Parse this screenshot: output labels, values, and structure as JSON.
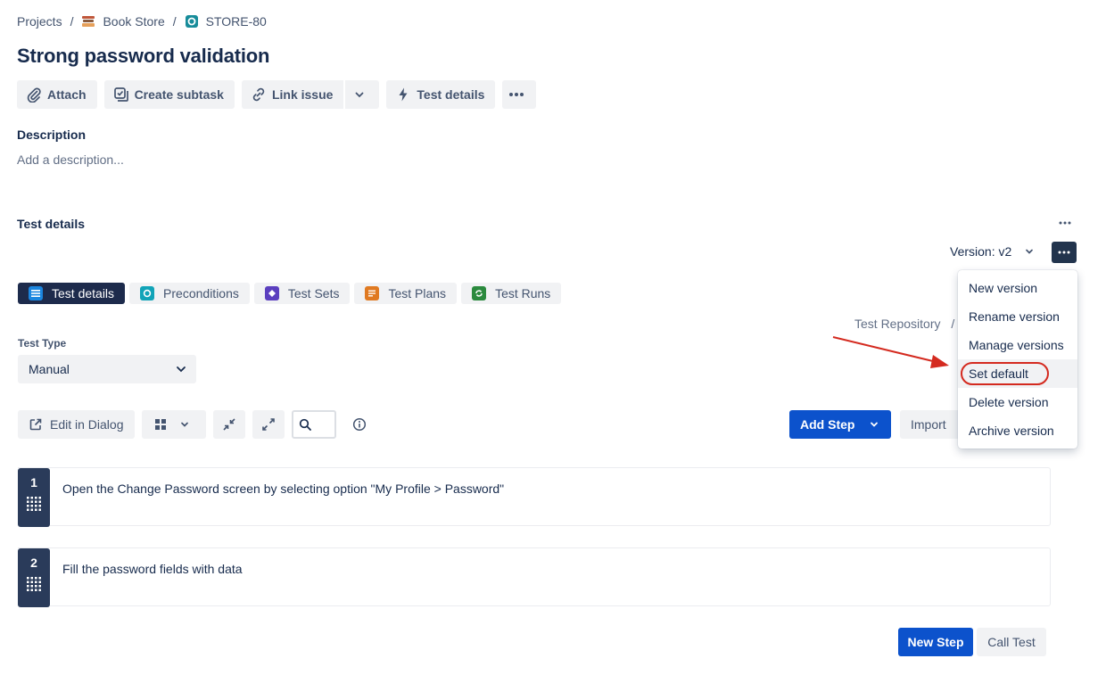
{
  "breadcrumb": {
    "projects": "Projects",
    "sep": "/",
    "project": "Book Store",
    "issue_key": "STORE-80"
  },
  "issue": {
    "title": "Strong password validation"
  },
  "toolbar": {
    "attach": "Attach",
    "create_subtask": "Create subtask",
    "link_issue": "Link issue",
    "test_details": "Test details"
  },
  "description": {
    "heading": "Description",
    "placeholder": "Add a description..."
  },
  "test_details": {
    "heading": "Test details",
    "version_label": "Version: v2",
    "tabs": [
      {
        "label": "Test details",
        "active": true,
        "color": "#1b86e0"
      },
      {
        "label": "Preconditions",
        "active": false,
        "color": "#12a4b8"
      },
      {
        "label": "Test Sets",
        "active": false,
        "color": "#5b3fbf"
      },
      {
        "label": "Test Plans",
        "active": false,
        "color": "#e07a22"
      },
      {
        "label": "Test Runs",
        "active": false,
        "color": "#2b8a3e"
      }
    ],
    "repo_path": "Test Repository",
    "repo_sep": "/",
    "test_type_label": "Test Type",
    "test_type_value": "Manual"
  },
  "steps_toolbar": {
    "edit_in_dialog": "Edit in Dialog",
    "add_step": "Add Step",
    "import": "Import"
  },
  "steps": [
    {
      "number": "1",
      "action": "Open the Change Password screen by selecting option \"My Profile > Password\""
    },
    {
      "number": "2",
      "action": "Fill the password fields with data"
    }
  ],
  "footer": {
    "new_step": "New Step",
    "call_test": "Call Test"
  },
  "version_menu": {
    "items": [
      {
        "label": "New version"
      },
      {
        "label": "Rename version"
      },
      {
        "label": "Manage versions"
      },
      {
        "label": "Set default",
        "highlighted": true
      },
      {
        "label": "Delete version"
      },
      {
        "label": "Archive version"
      }
    ]
  },
  "colors": {
    "primary": "#0c52cc",
    "annotation": "#d42a1f",
    "dark_nav": "#1d2b4c"
  }
}
